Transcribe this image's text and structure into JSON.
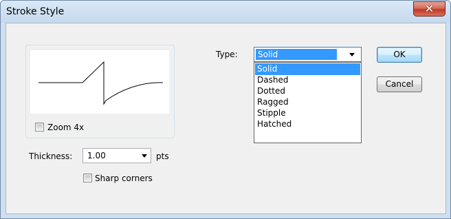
{
  "window": {
    "title": "Stroke Style",
    "close_glyph": "✕"
  },
  "preview": {
    "zoom_label": "Zoom 4x",
    "zoom_checked": false
  },
  "thickness": {
    "label": "Thickness:",
    "value": "1.00",
    "unit": "pts"
  },
  "sharp_corners": {
    "label": "Sharp corners",
    "checked": false
  },
  "type": {
    "label": "Type:",
    "selected": "Solid",
    "options": [
      "Solid",
      "Dashed",
      "Dotted",
      "Ragged",
      "Stipple",
      "Hatched"
    ],
    "highlighted_index": 0
  },
  "buttons": {
    "ok": "OK",
    "cancel": "Cancel"
  },
  "colors": {
    "selection": "#3399ff",
    "close_button": "#c8463a",
    "frame": "#cfdff0"
  }
}
